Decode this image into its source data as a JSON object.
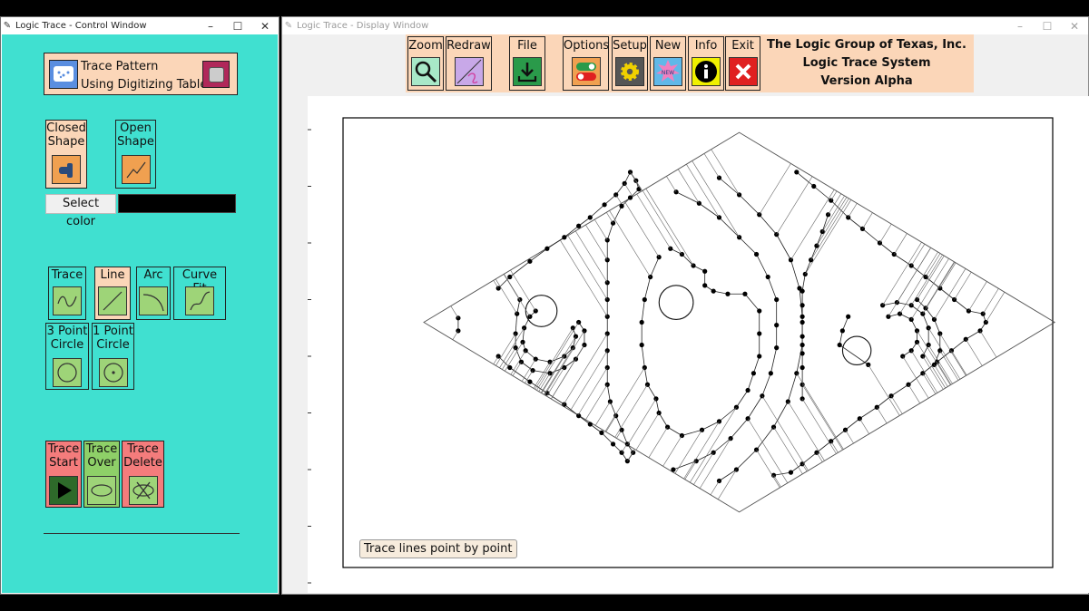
{
  "control_window": {
    "title": "Logic Trace - Control Window",
    "trace_pattern": {
      "line1": "Trace Pattern",
      "line2": "Using Digitizing Tablet"
    },
    "closed_shape": {
      "line1": "Closed",
      "line2": "Shape"
    },
    "open_shape": {
      "line1": "Open",
      "line2": "Shape"
    },
    "select_color_label": "Select color",
    "selected_color": "#000000",
    "tools": {
      "trace": "Trace",
      "line": "Line",
      "arc": "Arc",
      "curve_fit": "Curve Fit"
    },
    "circles": {
      "three_point": {
        "line1": "3 Point",
        "line2": "Circle"
      },
      "one_point": {
        "line1": "1 Point",
        "line2": "Circle"
      }
    },
    "trace_actions": {
      "start": {
        "line1": "Trace",
        "line2": "Start"
      },
      "over": {
        "line1": "Trace",
        "line2": "Over"
      },
      "delete": {
        "line1": "Trace",
        "line2": "Delete"
      }
    }
  },
  "display_window": {
    "title": "Logic Trace - Display Window",
    "toolbar": {
      "zoom": "Zoom",
      "redraw": "Redraw",
      "file": "File",
      "options": "Options",
      "setup": "Setup",
      "new": "New",
      "new_badge": "NEW",
      "info": "Info",
      "exit": "Exit"
    },
    "company": {
      "line1": "The Logic Group of Texas, Inc.",
      "line2": "Logic Trace System",
      "line3": "Version Alpha"
    },
    "status_message": "Trace lines point by point"
  },
  "window_controls": {
    "minimize": "–",
    "maximize": "☐",
    "close": "✕"
  },
  "chart_data": {
    "type": "scatter",
    "title": "",
    "xlabel": "",
    "ylabel": "",
    "ylim": [
      0,
      16.5
    ],
    "yticks": [
      "0",
      "2",
      "4",
      "6",
      "8",
      "10",
      "12",
      "14",
      "16"
    ],
    "outline": [
      [
        0,
        9.2
      ],
      [
        11,
        15.9
      ],
      [
        22,
        9.2
      ],
      [
        11,
        2.5
      ]
    ],
    "circles": [
      {
        "cx": 4.1,
        "cy": 9.6,
        "r": 0.55
      },
      {
        "cx": 8.8,
        "cy": 9.9,
        "r": 0.6
      },
      {
        "cx": 15.1,
        "cy": 8.2,
        "r": 0.5
      }
    ],
    "series": [
      {
        "points": [
          [
            1.2,
            9.35
          ],
          [
            1.2,
            8.9
          ],
          [
            2.6,
            10.4
          ],
          [
            3.0,
            10.8
          ],
          [
            3.7,
            11.35
          ],
          [
            4.3,
            11.8
          ],
          [
            4.9,
            12.2
          ],
          [
            5.4,
            12.6
          ],
          [
            5.8,
            12.9
          ],
          [
            6.3,
            13.35
          ],
          [
            6.7,
            13.7
          ],
          [
            7.0,
            14.1
          ],
          [
            7.2,
            14.5
          ],
          [
            7.4,
            14.2
          ],
          [
            7.5,
            13.9
          ],
          [
            7.2,
            13.6
          ],
          [
            6.9,
            13.3
          ],
          [
            6.6,
            12.7
          ],
          [
            6.4,
            12.1
          ],
          [
            6.4,
            11.4
          ],
          [
            6.4,
            10.6
          ],
          [
            6.4,
            10.0
          ],
          [
            6.4,
            9.4
          ],
          [
            6.4,
            8.8
          ],
          [
            6.4,
            8.2
          ],
          [
            6.4,
            7.6
          ],
          [
            6.4,
            7.0
          ],
          [
            6.5,
            6.4
          ],
          [
            6.7,
            5.9
          ],
          [
            6.9,
            5.4
          ],
          [
            7.1,
            4.9
          ],
          [
            7.3,
            4.6
          ],
          [
            7.1,
            4.3
          ],
          [
            6.9,
            4.6
          ],
          [
            6.6,
            4.9
          ],
          [
            6.2,
            5.3
          ],
          [
            5.8,
            5.6
          ],
          [
            5.4,
            5.9
          ],
          [
            4.9,
            6.3
          ],
          [
            4.3,
            6.7
          ],
          [
            3.7,
            7.1
          ],
          [
            3.0,
            7.6
          ],
          [
            2.6,
            8.0
          ],
          [
            3.9,
            9.6
          ],
          [
            3.7,
            9.4
          ],
          [
            3.5,
            9.0
          ],
          [
            3.45,
            8.5
          ],
          [
            3.55,
            8.2
          ],
          [
            3.9,
            7.9
          ],
          [
            4.4,
            7.8
          ],
          [
            4.9,
            8.0
          ],
          [
            5.2,
            8.3
          ],
          [
            5.3,
            8.7
          ],
          [
            5.2,
            9.0
          ],
          [
            3.35,
            10.0
          ],
          [
            3.25,
            9.5
          ],
          [
            3.2,
            8.8
          ],
          [
            3.2,
            8.3
          ],
          [
            3.4,
            7.8
          ],
          [
            3.8,
            7.5
          ],
          [
            4.4,
            7.4
          ],
          [
            4.9,
            7.6
          ],
          [
            5.3,
            7.9
          ],
          [
            5.6,
            8.4
          ],
          [
            5.6,
            8.9
          ],
          [
            5.4,
            9.2
          ],
          [
            8.6,
            11.8
          ],
          [
            9.0,
            11.6
          ],
          [
            9.4,
            11.2
          ],
          [
            9.8,
            11.0
          ],
          [
            9.8,
            10.5
          ],
          [
            10.1,
            10.3
          ],
          [
            10.6,
            10.2
          ],
          [
            11.2,
            10.2
          ],
          [
            11.7,
            9.6
          ],
          [
            11.7,
            8.8
          ],
          [
            11.7,
            8.0
          ],
          [
            11.5,
            7.4
          ],
          [
            11.3,
            6.8
          ],
          [
            10.9,
            6.2
          ],
          [
            10.3,
            5.7
          ],
          [
            9.7,
            5.4
          ],
          [
            9.0,
            5.2
          ],
          [
            8.5,
            5.5
          ],
          [
            8.2,
            6.0
          ],
          [
            8.1,
            6.5
          ],
          [
            7.8,
            7.0
          ],
          [
            7.7,
            7.6
          ],
          [
            7.6,
            8.4
          ],
          [
            7.6,
            9.2
          ],
          [
            7.7,
            10.0
          ],
          [
            7.9,
            10.8
          ],
          [
            8.2,
            11.5
          ],
          [
            8.8,
            13.8
          ],
          [
            9.6,
            13.4
          ],
          [
            10.3,
            12.9
          ],
          [
            11.0,
            12.2
          ],
          [
            11.6,
            11.6
          ],
          [
            12.0,
            10.8
          ],
          [
            12.3,
            10.0
          ],
          [
            12.3,
            9.1
          ],
          [
            12.3,
            8.3
          ],
          [
            12.1,
            7.4
          ],
          [
            11.8,
            6.6
          ],
          [
            11.3,
            5.8
          ],
          [
            10.7,
            5.1
          ],
          [
            10.1,
            4.6
          ],
          [
            9.5,
            4.3
          ],
          [
            8.7,
            4.0
          ],
          [
            10.3,
            14.3
          ],
          [
            11.0,
            13.7
          ],
          [
            11.7,
            13.0
          ],
          [
            12.3,
            12.3
          ],
          [
            12.8,
            11.4
          ],
          [
            13.1,
            10.4
          ],
          [
            13.2,
            9.4
          ],
          [
            13.2,
            8.4
          ],
          [
            13.0,
            7.4
          ],
          [
            12.7,
            6.4
          ],
          [
            12.2,
            5.5
          ],
          [
            11.6,
            4.7
          ],
          [
            10.9,
            4.0
          ],
          [
            10.3,
            3.6
          ],
          [
            13.0,
            14.5
          ],
          [
            13.6,
            14.0
          ],
          [
            14.2,
            13.5
          ],
          [
            14.8,
            12.9
          ],
          [
            15.3,
            12.5
          ],
          [
            15.9,
            12.0
          ],
          [
            16.4,
            11.6
          ],
          [
            17.0,
            11.2
          ],
          [
            17.5,
            10.8
          ],
          [
            18.0,
            10.4
          ],
          [
            18.5,
            10.0
          ],
          [
            19.0,
            9.6
          ],
          [
            19.5,
            9.5
          ],
          [
            19.6,
            9.2
          ],
          [
            19.4,
            8.9
          ],
          [
            18.9,
            8.6
          ],
          [
            18.4,
            8.2
          ],
          [
            17.9,
            7.8
          ],
          [
            17.4,
            7.4
          ],
          [
            16.9,
            7.0
          ],
          [
            16.3,
            6.6
          ],
          [
            15.8,
            6.2
          ],
          [
            15.2,
            5.8
          ],
          [
            14.7,
            5.4
          ],
          [
            14.2,
            5.0
          ],
          [
            13.7,
            4.6
          ],
          [
            13.2,
            4.2
          ],
          [
            12.8,
            3.9
          ],
          [
            12.2,
            3.8
          ],
          [
            13.2,
            6.5
          ],
          [
            13.2,
            7.0
          ],
          [
            13.2,
            7.6
          ],
          [
            13.2,
            8.1
          ],
          [
            13.2,
            8.7
          ],
          [
            13.2,
            9.2
          ],
          [
            13.2,
            9.8
          ],
          [
            13.2,
            10.3
          ],
          [
            13.3,
            10.9
          ],
          [
            13.5,
            11.4
          ],
          [
            13.7,
            11.9
          ],
          [
            13.9,
            12.4
          ],
          [
            14.1,
            13.0
          ],
          [
            16.0,
            9.8
          ],
          [
            16.5,
            9.9
          ],
          [
            17.0,
            9.8
          ],
          [
            17.4,
            9.5
          ],
          [
            17.6,
            9.0
          ],
          [
            17.6,
            8.4
          ],
          [
            17.4,
            8.0
          ],
          [
            16.2,
            9.4
          ],
          [
            16.6,
            9.5
          ],
          [
            17.0,
            9.3
          ],
          [
            17.2,
            8.9
          ],
          [
            17.2,
            8.5
          ],
          [
            17.0,
            8.2
          ],
          [
            16.7,
            8.0
          ],
          [
            14.8,
            9.4
          ],
          [
            14.6,
            8.9
          ],
          [
            14.5,
            8.4
          ],
          [
            15.5,
            7.7
          ],
          [
            17.8,
            7.7
          ],
          [
            18.0,
            8.2
          ],
          [
            18.0,
            8.8
          ],
          [
            17.8,
            9.3
          ],
          [
            17.5,
            9.7
          ],
          [
            17.2,
            10.0
          ]
        ]
      }
    ]
  }
}
